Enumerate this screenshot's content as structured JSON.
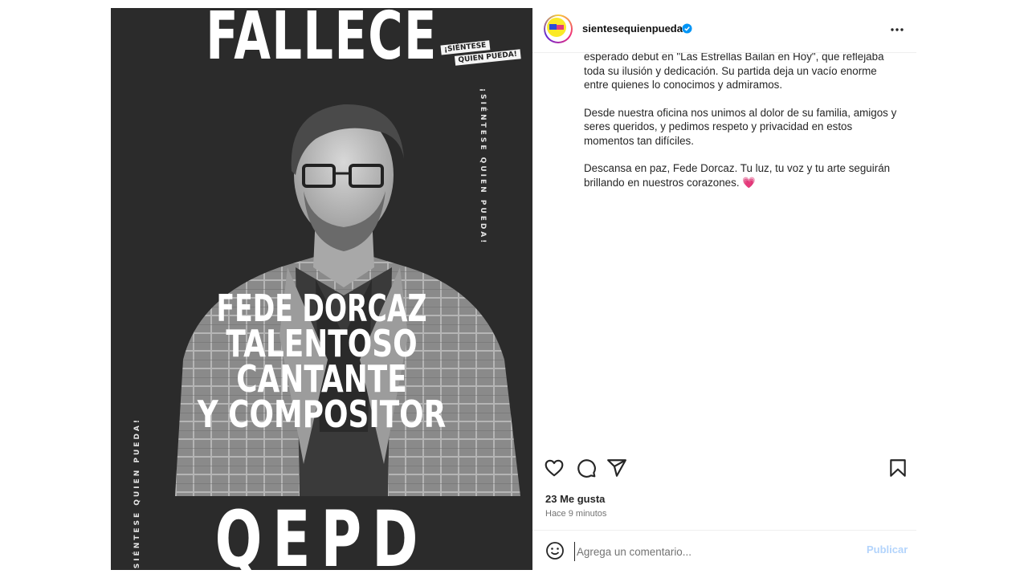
{
  "image": {
    "headline_top": "FALLECE",
    "stamp_line1": "¡SIÉNTESE",
    "stamp_line2": "QUIEN PUEDA!",
    "vertical_right": "¡SIÉNTESE QUIEN PUEDA!",
    "vertical_left": "¡SIÉNTESE QUIEN PUEDA!",
    "overlay_lines": [
      "FEDE DORCAZ",
      "TALENTOSO CANTANTE",
      "Y COMPOSITOR"
    ],
    "headline_bottom": "QEPD"
  },
  "header": {
    "username": "sientesequienpueda",
    "verified": true,
    "more_icon": "more-horizontal-icon"
  },
  "caption": {
    "paragraphs": [
      "esperado debut en \"Las Estrellas Bailan en Hoy\", que reflejaba toda su ilusión y dedicación. Su partida deja un vacío enorme entre quienes lo conocimos y admiramos.",
      "Desde nuestra oficina nos unimos al dolor de su familia, amigos y seres queridos, y pedimos respeto y privacidad en estos momentos tan difíciles.",
      "Descansa en paz, Fede Dorcaz. Tu luz, tu voz y tu arte seguirán brillando en nuestros corazones."
    ],
    "emoji": "💗"
  },
  "actions": {
    "like_icon": "heart-icon",
    "comment_icon": "comment-icon",
    "share_icon": "send-icon",
    "save_icon": "bookmark-icon",
    "likes_text": "23 Me gusta",
    "time_text": "Hace 9 minutos"
  },
  "comment": {
    "emoji_icon": "smiley-icon",
    "placeholder": "Agrega un comentario...",
    "publish_label": "Publicar"
  },
  "colors": {
    "image_bg": "#2b2b2b",
    "verified_blue": "#0095f6",
    "publish_disabled": "#b3d4fc",
    "avatar_yellow": "#fbe927"
  }
}
